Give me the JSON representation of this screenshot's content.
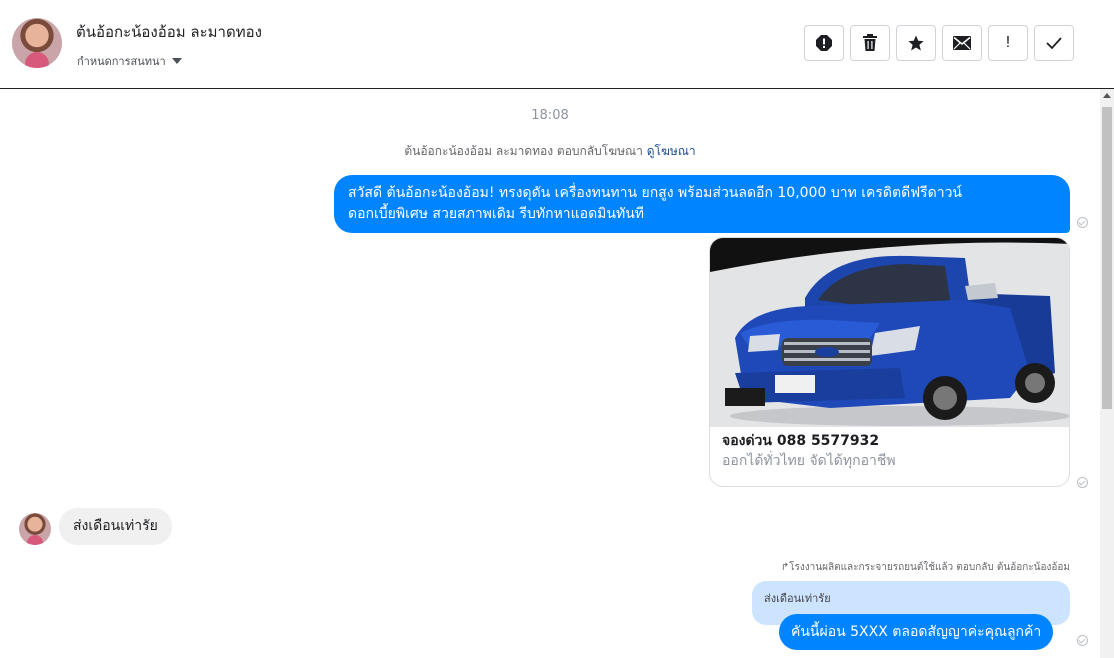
{
  "header": {
    "contact_name": "ต้นอ้อกะน้องอ้อม ละมาดทอง",
    "conversation_settings": "กำหนดการสนทนา",
    "toolbar": [
      {
        "name": "alert-icon"
      },
      {
        "name": "trash-icon"
      },
      {
        "name": "star-icon"
      },
      {
        "name": "envelope-icon"
      },
      {
        "name": "exclamation-icon",
        "label": "!"
      },
      {
        "name": "checkmark-icon"
      }
    ]
  },
  "chat": {
    "timestamp": "18:08",
    "ad_reply_text": "ต้นอ้อกะน้องอ้อม ละมาดทอง ตอบกลับโฆษณา",
    "ad_reply_link": "ดูโฆษณา",
    "messages": [
      {
        "line1": "สวัสดี ต้นอ้อกะน้องอ้อม!  ทรงดุดัน เครื่องทนทาน ยกสูง พร้อมส่วนลดอีก 10,000 บาท เครดิตดีฟรีดาวน์",
        "line2": "ดอกเบี้ยพิเศษ สวยสภาพเดิม รีบทักหาแอดมินทันที"
      }
    ],
    "ad_card": {
      "title": "จองด่วน 088 5577932",
      "subtitle": "ออกได้ทั่วไทย จัดได้ทุกอาชีพ"
    },
    "incoming": "ส่งเดือนเท่ารัย",
    "reply_meta": "↱โรงงานผลิตและกระจายรถยนต์ใช้แล้ว ตอบกลับ ต้นอ้อกะน้องอ้อม",
    "quoted_text": "ส่งเดือนเท่ารัย",
    "last_outgoing": "คันนี้ผ่อน 5XXX ตลอดสัญญาค่ะคุณลูกค้า"
  },
  "colors": {
    "outgoing_bubble": "#0084ff",
    "incoming_bubble": "#f0f0f0",
    "quoted_bubble": "#cce4ff",
    "car_body": "#1f49b8"
  }
}
